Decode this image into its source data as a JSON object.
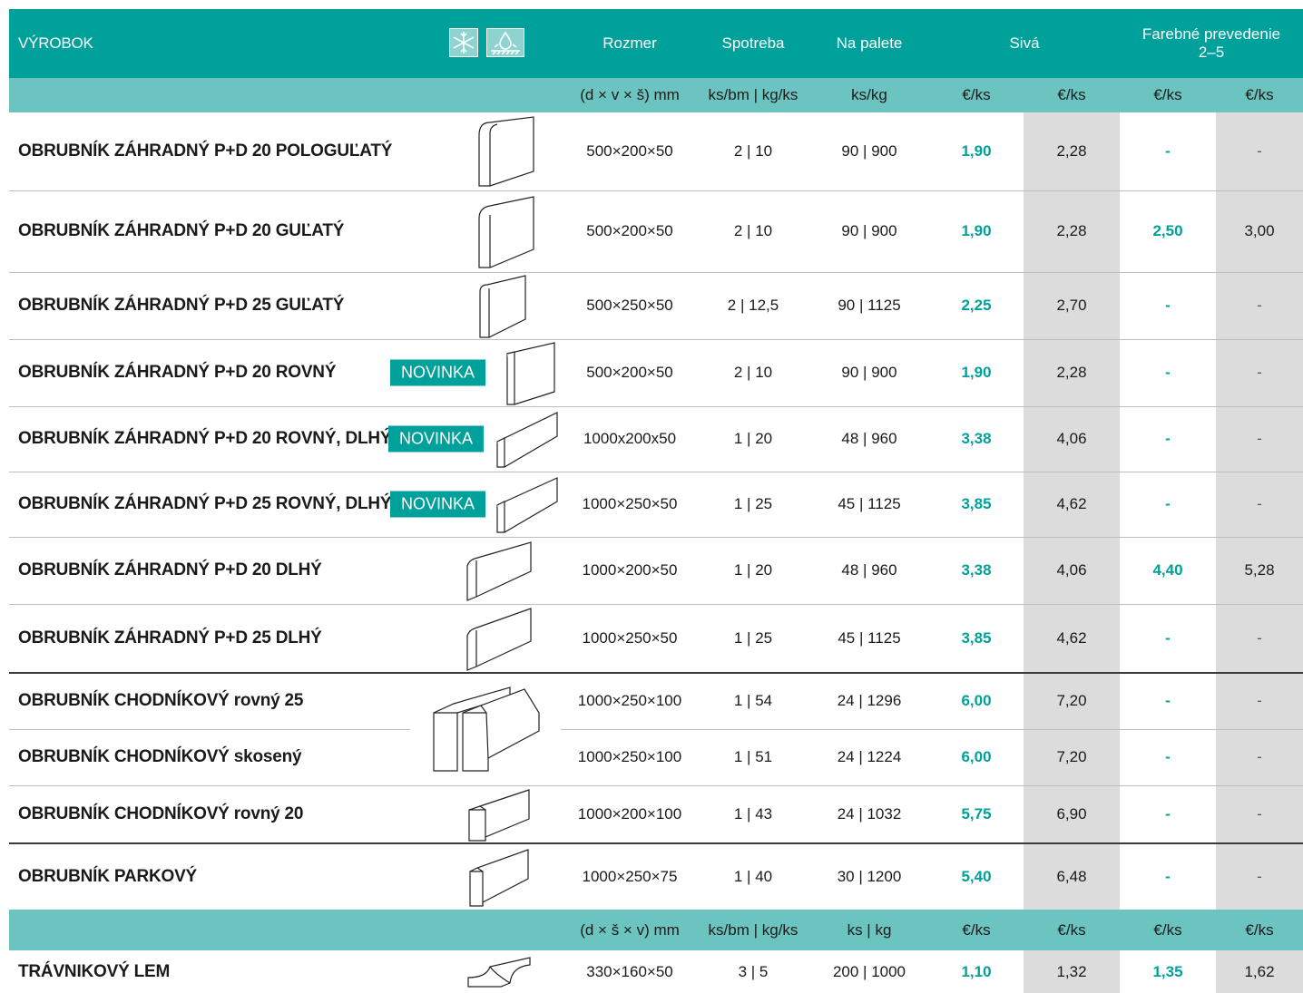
{
  "header": {
    "product": "VÝROBOK",
    "rozmer": "Rozmer",
    "spotreba": "Spotreba",
    "na_palete": "Na palete",
    "siva": "Sivá",
    "farebne": "Farebné prevedenie",
    "farebne_range": "2–5",
    "icons": [
      "snowflake-icon",
      "water-drop-icon"
    ]
  },
  "subheader1": {
    "rozmer": "(d × v × š) mm",
    "spotreba": "ks/bm | kg/ks",
    "na_palete": "ks/kg",
    "s1": "€/ks",
    "s2": "€/ks",
    "f1": "€/ks",
    "f2": "€/ks"
  },
  "subheader2": {
    "rozmer": "(d × š × v) mm",
    "spotreba": "ks/bm | kg/ks",
    "na_palete": "ks | kg",
    "s1": "€/ks",
    "s2": "€/ks",
    "f1": "€/ks",
    "f2": "€/ks"
  },
  "badge_label": "NOVINKA",
  "rows": [
    {
      "name": "OBRUBNÍK ZÁHRADNÝ P+D 20 POLOGUĽATÝ",
      "rozmer": "500×200×50",
      "spotreba": "2 | 10",
      "paleta": "90 | 900",
      "s1": "1,90",
      "s2": "2,28",
      "f1": "-",
      "f2": "-"
    },
    {
      "name": "OBRUBNÍK ZÁHRADNÝ P+D 20 GUĽATÝ",
      "rozmer": "500×200×50",
      "spotreba": "2 | 10",
      "paleta": "90 | 900",
      "s1": "1,90",
      "s2": "2,28",
      "f1": "2,50",
      "f2": "3,00"
    },
    {
      "name": "OBRUBNÍK ZÁHRADNÝ P+D 25 GUĽATÝ",
      "rozmer": "500×250×50",
      "spotreba": "2 | 12,5",
      "paleta": "90 | 1125",
      "s1": "2,25",
      "s2": "2,70",
      "f1": "-",
      "f2": "-"
    },
    {
      "name": "OBRUBNÍK ZÁHRADNÝ P+D 20 ROVNÝ",
      "rozmer": "500×200×50",
      "spotreba": "2 | 10",
      "paleta": "90 | 900",
      "s1": "1,90",
      "s2": "2,28",
      "f1": "-",
      "f2": "-"
    },
    {
      "name": "OBRUBNÍK ZÁHRADNÝ P+D 20 ROVNÝ, DLHÝ",
      "rozmer": "1000x200x50",
      "spotreba": "1 | 20",
      "paleta": "48 | 960",
      "s1": "3,38",
      "s2": "4,06",
      "f1": "-",
      "f2": "-"
    },
    {
      "name": "OBRUBNÍK ZÁHRADNÝ P+D 25 ROVNÝ, DLHÝ",
      "rozmer": "1000×250×50",
      "spotreba": "1 | 25",
      "paleta": "45 | 1125",
      "s1": "3,85",
      "s2": "4,62",
      "f1": "-",
      "f2": "-"
    },
    {
      "name": "OBRUBNÍK ZÁHRADNÝ P+D 20 DLHÝ",
      "rozmer": "1000×200×50",
      "spotreba": "1 | 20",
      "paleta": "48 | 960",
      "s1": "3,38",
      "s2": "4,06",
      "f1": "4,40",
      "f2": "5,28"
    },
    {
      "name": "OBRUBNÍK ZÁHRADNÝ P+D 25 DLHÝ",
      "rozmer": "1000×250×50",
      "spotreba": "1 | 25",
      "paleta": "45 | 1125",
      "s1": "3,85",
      "s2": "4,62",
      "f1": "-",
      "f2": "-"
    },
    {
      "name": "OBRUBNÍK CHODNÍKOVÝ rovný 25",
      "rozmer": "1000×250×100",
      "spotreba": "1 | 54",
      "paleta": "24 | 1296",
      "s1": "6,00",
      "s2": "7,20",
      "f1": "-",
      "f2": "-"
    },
    {
      "name": "OBRUBNÍK CHODNÍKOVÝ skosený",
      "rozmer": "1000×250×100",
      "spotreba": "1 | 51",
      "paleta": "24 | 1224",
      "s1": "6,00",
      "s2": "7,20",
      "f1": "-",
      "f2": "-"
    },
    {
      "name": "OBRUBNÍK CHODNÍKOVÝ rovný 20",
      "rozmer": "1000×200×100",
      "spotreba": "1 | 43",
      "paleta": "24 | 1032",
      "s1": "5,75",
      "s2": "6,90",
      "f1": "-",
      "f2": "-"
    },
    {
      "name": "OBRUBNÍK PARKOVÝ",
      "rozmer": "1000×250×75",
      "spotreba": "1 | 40",
      "paleta": "30 | 1200",
      "s1": "5,40",
      "s2": "6,48",
      "f1": "-",
      "f2": "-"
    },
    {
      "name": "TRÁVNIKOVÝ LEM",
      "rozmer": "330×160×50",
      "spotreba": "3 | 5",
      "paleta": "200 | 1000",
      "s1": "1,10",
      "s2": "1,32",
      "f1": "1,35",
      "f2": "1,62"
    }
  ],
  "colors": {
    "teal": "#00a19a",
    "teal_light": "#6cc4c1",
    "grey_band": "#dcdcdc"
  }
}
